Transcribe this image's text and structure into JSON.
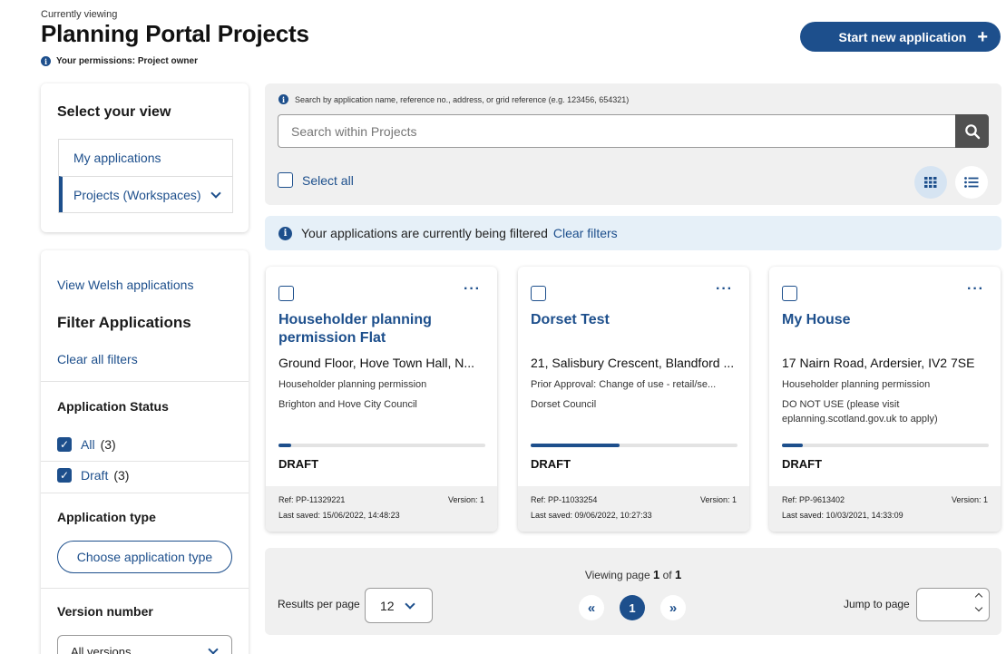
{
  "header": {
    "subtitle": "Currently viewing",
    "title": "Planning Portal Projects",
    "permissions": "Your permissions: Project owner",
    "start_button": "Start new application"
  },
  "view_panel": {
    "title": "Select your view",
    "items": [
      {
        "label": "My applications"
      },
      {
        "label": "Projects (Workspaces)"
      }
    ]
  },
  "filters": {
    "welsh_link": "View Welsh applications",
    "title": "Filter Applications",
    "clear_all": "Clear all filters",
    "status_heading": "Application Status",
    "status_options": [
      {
        "label": "All",
        "count": "(3)",
        "checked": true
      },
      {
        "label": "Draft",
        "count": "(3)",
        "checked": true
      }
    ],
    "type_heading": "Application type",
    "type_button": "Choose application type",
    "version_heading": "Version number",
    "version_value": "All versions"
  },
  "search": {
    "hint": "Search by application name, reference no., address, or grid reference (e.g. 123456, 654321)",
    "placeholder": "Search within Projects",
    "select_all": "Select all"
  },
  "banner": {
    "text": "Your applications are currently being filtered",
    "link": "Clear filters"
  },
  "cards": [
    {
      "title": "Householder planning permission Flat",
      "address": "Ground Floor, Hove Town Hall, N...",
      "type": "Householder planning permission",
      "council": "Brighton and Hove City Council",
      "progress": 0.06,
      "status": "DRAFT",
      "ref": "Ref: PP-11329221",
      "version": "Version: 1",
      "saved": "Last saved: 15/06/2022, 14:48:23"
    },
    {
      "title": "Dorset Test",
      "address": "21, Salisbury Crescent, Blandford ...",
      "type": "Prior Approval: Change of use - retail/se...",
      "council": "Dorset Council",
      "progress": 0.43,
      "status": "DRAFT",
      "ref": "Ref: PP-11033254",
      "version": "Version: 1",
      "saved": "Last saved: 09/06/2022, 10:27:33"
    },
    {
      "title": "My House",
      "address": "17 Nairn Road, Ardersier, IV2 7SE",
      "type": "Householder planning permission",
      "council": "DO NOT USE (please visit eplanning.scotland.gov.uk to apply)",
      "progress": 0.1,
      "status": "DRAFT",
      "ref": "Ref: PP-9613402",
      "version": "Version: 1",
      "saved": "Last saved: 10/03/2021, 14:33:09"
    }
  ],
  "pager": {
    "viewing_prefix": "Viewing page",
    "current": "1",
    "of_word": "of",
    "total": "1",
    "rpp_label": "Results per page",
    "rpp_value": "12",
    "prev": "«",
    "next": "»",
    "jump_label": "Jump to page"
  },
  "colors": {
    "brand": "#1d4f8c",
    "panel_bg": "#f0f0f0",
    "banner_bg": "#e6f0f8"
  }
}
